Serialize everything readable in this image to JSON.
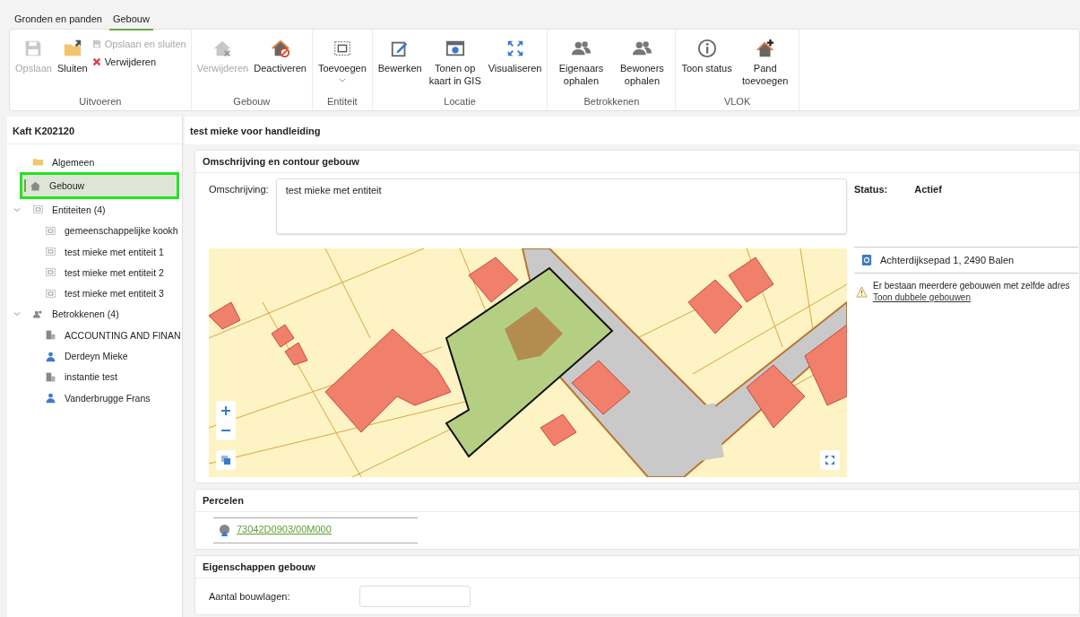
{
  "ribbon_tabs": [
    {
      "label": "Gronden en panden",
      "selected": false
    },
    {
      "label": "Gebouw",
      "selected": true
    }
  ],
  "ribbon_groups": [
    {
      "label": "Uitvoeren",
      "buttons": [
        {
          "label": "Opslaan",
          "kind": "disk",
          "disabled": true
        },
        {
          "label": "Sluiten",
          "kind": "folder",
          "disabled": false
        },
        {
          "label": "Opslaan en sluiten",
          "kind": "disklet",
          "disabled": true
        },
        {
          "label": "Verwijderen",
          "kind": "cross",
          "disabled": false
        }
      ]
    },
    {
      "label": "Gebouw",
      "buttons": [
        {
          "label": "Verwijderen",
          "kind": "housex",
          "disabled": true
        },
        {
          "label": "Deactiveren",
          "kind": "houseban",
          "disabled": false
        }
      ]
    },
    {
      "label": "Entiteit",
      "buttons": [
        {
          "label": "Toevoegen",
          "kind": "selection",
          "disabled": false
        }
      ]
    },
    {
      "label": "Locatie",
      "buttons": [
        {
          "label": "Bewerken",
          "kind": "edit",
          "disabled": false
        },
        {
          "label": "Tonen op kaart in GIS",
          "kind": "globe",
          "disabled": false
        },
        {
          "label": "Visualiseren",
          "kind": "expand",
          "disabled": false
        }
      ]
    },
    {
      "label": "Betrokkenen",
      "buttons": [
        {
          "label": "Eigenaars ophalen",
          "kind": "people",
          "disabled": false
        },
        {
          "label": "Bewoners ophalen",
          "kind": "people",
          "disabled": false
        }
      ]
    },
    {
      "label": "VLOK",
      "buttons": [
        {
          "label": "Toon status",
          "kind": "info",
          "disabled": false
        },
        {
          "label": "Pand toevoegen",
          "kind": "houseplus",
          "disabled": false
        }
      ]
    }
  ],
  "sidebar": {
    "title": "Kaft K202120",
    "items": [
      {
        "label": "Algemeen",
        "kind": "folder",
        "selected": false
      },
      {
        "label": "Gebouw",
        "kind": "house",
        "selected": true
      },
      {
        "label": "Entiteiten (4)",
        "kind": "selection",
        "selected": false,
        "expanded": true,
        "children": [
          {
            "label": "gemeenschappelijke kookh",
            "kind": "selection",
            "selected": false
          },
          {
            "label": "test mieke met entiteit 1",
            "kind": "selection",
            "selected": false
          },
          {
            "label": "test mieke met entiteit 2",
            "kind": "selection",
            "selected": false
          },
          {
            "label": "test mieke met entiteit 3",
            "kind": "selection",
            "selected": false
          }
        ]
      },
      {
        "label": "Betrokkenen (4)",
        "kind": "people",
        "selected": false,
        "expanded": true,
        "children": [
          {
            "label": "ACCOUNTING AND FINAN",
            "kind": "building",
            "selected": false
          },
          {
            "label": "Derdeyn Mieke",
            "kind": "person",
            "selected": false
          },
          {
            "label": "instantie test",
            "kind": "building",
            "selected": false
          },
          {
            "label": "Vanderbrugge Frans",
            "kind": "person",
            "selected": false
          }
        ]
      }
    ]
  },
  "content": {
    "title": "test mieke voor handleiding",
    "description_panel": {
      "title": "Omschrijving en contour gebouw",
      "description_label": "Omschrijving:",
      "description_value": "test mieke met entiteit",
      "status_label": "Status:",
      "status_value": "Actief",
      "address": "Achterdijksepad 1, 2490 Balen",
      "warning": "Er bestaan meerdere gebouwen met zelfde adres",
      "warning_link": "Toon dubbele gebouwen"
    },
    "parcels_panel": {
      "title": "Percelen",
      "parcels": [
        "73042D0903/00M000"
      ]
    },
    "properties_panel": {
      "title": "Eigenschappen gebouw",
      "fields": [
        {
          "label": "Aantal bouwlagen:"
        }
      ]
    }
  }
}
